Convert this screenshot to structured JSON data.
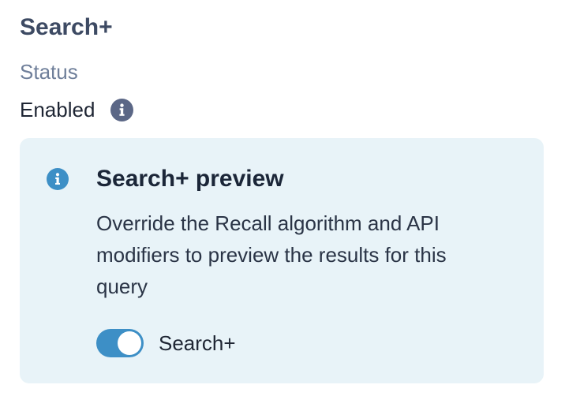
{
  "section": {
    "title": "Search+"
  },
  "status": {
    "label": "Status",
    "value": "Enabled",
    "info_icon": "info-icon"
  },
  "preview": {
    "icon": "info-icon",
    "title": "Search+ preview",
    "description": "Override the Recall algorithm and API modifiers to preview the results for this query",
    "toggle": {
      "label": "Search+",
      "checked": true
    }
  },
  "colors": {
    "title": "#3d4a63",
    "muted": "#6f7f9a",
    "callout_bg": "#e8f3f8",
    "accent": "#3d8fc6",
    "status_icon": "#5b6786"
  }
}
